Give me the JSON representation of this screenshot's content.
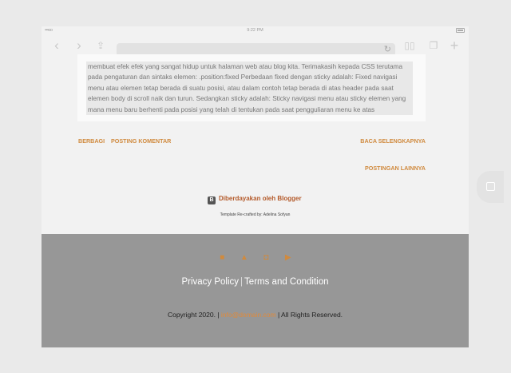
{
  "statusbar": {
    "signal": "•••oo",
    "time": "9:22 PM"
  },
  "toolbar": {
    "back_icon": "chevron-left-icon",
    "forward_icon": "chevron-right-icon",
    "share_icon": "share-icon",
    "reload_icon": "reload-icon",
    "bookmarks_icon": "book-icon",
    "tabs_icon": "tabs-icon",
    "new_tab_icon": "plus-icon"
  },
  "article": {
    "text": "membuat efek efek yang sangat hidup untuk halaman web atau blog kita. Terimakasih kepada CSS terutama pada pengaturan dan sintaks elemen: .position:fixed Perbedaan fixed dengan sticky adalah: Fixed navigasi menu atau elemen tetap berada di suatu posisi, atau dalam contoh tetap berada di atas header pada saat elemen body di scroll naik dan turun. Sedangkan sticky adalah: Sticky navigasi menu atau sticky elemen yang mana menu baru berhenti pada posisi yang telah di tentukan pada saat pengguliaran menu ke atas"
  },
  "post_links": {
    "share": "BERBAGI",
    "post_comment": "POSTING KOMENTAR",
    "read_more": "BACA SELENGKAPNYA",
    "more_posts": "POSTINGAN LAINNYA"
  },
  "powered_by": "Diberdayakan oleh Blogger",
  "template_credit": "Template Re-crafted by: Adelina Sofyan",
  "footer": {
    "social_icons": [
      "facebook-icon",
      "twitter-icon",
      "instagram-icon",
      "youtube-icon"
    ],
    "privacy_policy": "Privacy Policy",
    "separator": "|",
    "terms": "Terms and Condition",
    "copyright_prefix": "Copyright 2020. |",
    "email": "info@domain.com",
    "copyright_suffix": "| All Rights Reserved."
  },
  "colors": {
    "accent": "#d08a3e",
    "footer_bg": "#979797",
    "page_bg": "#f2f2f2"
  }
}
